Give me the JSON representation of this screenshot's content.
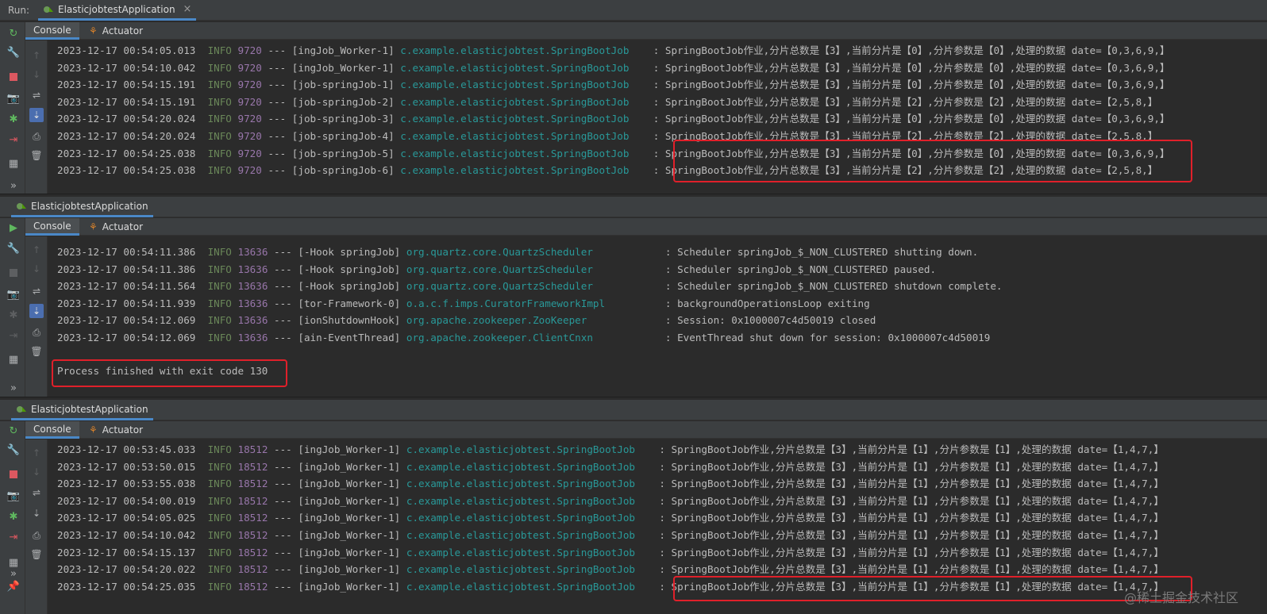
{
  "run_label": "Run:",
  "app_name": "ElasticjobtestApplication",
  "close_glyph": "×",
  "subtabs": {
    "console": "Console",
    "actuator": "Actuator"
  },
  "more_glyph": "»",
  "panel1": {
    "lines": [
      {
        "ts": "2023-12-17 00:54:05.013",
        "level": "INFO",
        "pid": "9720",
        "dash": "---",
        "thread": "[ingJob_Worker-1]",
        "logger": "c.example.elasticjobtest.SpringBootJob",
        "msg": ": SpringBootJob作业,分片总数是【3】,当前分片是【0】,分片参数是【0】,处理的数据 date=【0,3,6,9,】"
      },
      {
        "ts": "2023-12-17 00:54:10.042",
        "level": "INFO",
        "pid": "9720",
        "dash": "---",
        "thread": "[ingJob_Worker-1]",
        "logger": "c.example.elasticjobtest.SpringBootJob",
        "msg": ": SpringBootJob作业,分片总数是【3】,当前分片是【0】,分片参数是【0】,处理的数据 date=【0,3,6,9,】"
      },
      {
        "ts": "2023-12-17 00:54:15.191",
        "level": "INFO",
        "pid": "9720",
        "dash": "---",
        "thread": "[job-springJob-1]",
        "logger": "c.example.elasticjobtest.SpringBootJob",
        "msg": ": SpringBootJob作业,分片总数是【3】,当前分片是【0】,分片参数是【0】,处理的数据 date=【0,3,6,9,】"
      },
      {
        "ts": "2023-12-17 00:54:15.191",
        "level": "INFO",
        "pid": "9720",
        "dash": "---",
        "thread": "[job-springJob-2]",
        "logger": "c.example.elasticjobtest.SpringBootJob",
        "msg": ": SpringBootJob作业,分片总数是【3】,当前分片是【2】,分片参数是【2】,处理的数据 date=【2,5,8,】"
      },
      {
        "ts": "2023-12-17 00:54:20.024",
        "level": "INFO",
        "pid": "9720",
        "dash": "---",
        "thread": "[job-springJob-3]",
        "logger": "c.example.elasticjobtest.SpringBootJob",
        "msg": ": SpringBootJob作业,分片总数是【3】,当前分片是【0】,分片参数是【0】,处理的数据 date=【0,3,6,9,】"
      },
      {
        "ts": "2023-12-17 00:54:20.024",
        "level": "INFO",
        "pid": "9720",
        "dash": "---",
        "thread": "[job-springJob-4]",
        "logger": "c.example.elasticjobtest.SpringBootJob",
        "msg": ": SpringBootJob作业,分片总数是【3】,当前分片是【2】,分片参数是【2】,处理的数据 date=【2,5,8,】"
      },
      {
        "ts": "2023-12-17 00:54:25.038",
        "level": "INFO",
        "pid": "9720",
        "dash": "---",
        "thread": "[job-springJob-5]",
        "logger": "c.example.elasticjobtest.SpringBootJob",
        "msg": ": SpringBootJob作业,分片总数是【3】,当前分片是【0】,分片参数是【0】,处理的数据 date=【0,3,6,9,】"
      },
      {
        "ts": "2023-12-17 00:54:25.038",
        "level": "INFO",
        "pid": "9720",
        "dash": "---",
        "thread": "[job-springJob-6]",
        "logger": "c.example.elasticjobtest.SpringBootJob",
        "msg": ": SpringBootJob作业,分片总数是【3】,当前分片是【2】,分片参数是【2】,处理的数据 date=【2,5,8,】"
      }
    ]
  },
  "panel2": {
    "lines": [
      {
        "ts": "2023-12-17 00:54:11.386",
        "level": "INFO",
        "pid": "13636",
        "dash": "---",
        "thread": "[-Hook springJob]",
        "logger": "org.quartz.core.QuartzScheduler",
        "msg": ": Scheduler springJob_$_NON_CLUSTERED shutting down."
      },
      {
        "ts": "2023-12-17 00:54:11.386",
        "level": "INFO",
        "pid": "13636",
        "dash": "---",
        "thread": "[-Hook springJob]",
        "logger": "org.quartz.core.QuartzScheduler",
        "msg": ": Scheduler springJob_$_NON_CLUSTERED paused."
      },
      {
        "ts": "2023-12-17 00:54:11.564",
        "level": "INFO",
        "pid": "13636",
        "dash": "---",
        "thread": "[-Hook springJob]",
        "logger": "org.quartz.core.QuartzScheduler",
        "msg": ": Scheduler springJob_$_NON_CLUSTERED shutdown complete."
      },
      {
        "ts": "2023-12-17 00:54:11.939",
        "level": "INFO",
        "pid": "13636",
        "dash": "---",
        "thread": "[tor-Framework-0]",
        "logger": "o.a.c.f.imps.CuratorFrameworkImpl",
        "msg": ": backgroundOperationsLoop exiting"
      },
      {
        "ts": "2023-12-17 00:54:12.069",
        "level": "INFO",
        "pid": "13636",
        "dash": "---",
        "thread": "[ionShutdownHook]",
        "logger": "org.apache.zookeeper.ZooKeeper",
        "msg": ": Session: 0x1000007c4d50019 closed"
      },
      {
        "ts": "2023-12-17 00:54:12.069",
        "level": "INFO",
        "pid": "13636",
        "dash": "---",
        "thread": "[ain-EventThread]",
        "logger": "org.apache.zookeeper.ClientCnxn",
        "msg": ": EventThread shut down for session: 0x1000007c4d50019"
      }
    ],
    "process_finished": "Process finished with exit code 130"
  },
  "panel3": {
    "lines": [
      {
        "ts": "2023-12-17 00:53:45.033",
        "level": "INFO",
        "pid": "18512",
        "dash": "---",
        "thread": "[ingJob_Worker-1]",
        "logger": "c.example.elasticjobtest.SpringBootJob",
        "msg": ": SpringBootJob作业,分片总数是【3】,当前分片是【1】,分片参数是【1】,处理的数据 date=【1,4,7,】"
      },
      {
        "ts": "2023-12-17 00:53:50.015",
        "level": "INFO",
        "pid": "18512",
        "dash": "---",
        "thread": "[ingJob_Worker-1]",
        "logger": "c.example.elasticjobtest.SpringBootJob",
        "msg": ": SpringBootJob作业,分片总数是【3】,当前分片是【1】,分片参数是【1】,处理的数据 date=【1,4,7,】"
      },
      {
        "ts": "2023-12-17 00:53:55.038",
        "level": "INFO",
        "pid": "18512",
        "dash": "---",
        "thread": "[ingJob_Worker-1]",
        "logger": "c.example.elasticjobtest.SpringBootJob",
        "msg": ": SpringBootJob作业,分片总数是【3】,当前分片是【1】,分片参数是【1】,处理的数据 date=【1,4,7,】"
      },
      {
        "ts": "2023-12-17 00:54:00.019",
        "level": "INFO",
        "pid": "18512",
        "dash": "---",
        "thread": "[ingJob_Worker-1]",
        "logger": "c.example.elasticjobtest.SpringBootJob",
        "msg": ": SpringBootJob作业,分片总数是【3】,当前分片是【1】,分片参数是【1】,处理的数据 date=【1,4,7,】"
      },
      {
        "ts": "2023-12-17 00:54:05.025",
        "level": "INFO",
        "pid": "18512",
        "dash": "---",
        "thread": "[ingJob_Worker-1]",
        "logger": "c.example.elasticjobtest.SpringBootJob",
        "msg": ": SpringBootJob作业,分片总数是【3】,当前分片是【1】,分片参数是【1】,处理的数据 date=【1,4,7,】"
      },
      {
        "ts": "2023-12-17 00:54:10.042",
        "level": "INFO",
        "pid": "18512",
        "dash": "---",
        "thread": "[ingJob_Worker-1]",
        "logger": "c.example.elasticjobtest.SpringBootJob",
        "msg": ": SpringBootJob作业,分片总数是【3】,当前分片是【1】,分片参数是【1】,处理的数据 date=【1,4,7,】"
      },
      {
        "ts": "2023-12-17 00:54:15.137",
        "level": "INFO",
        "pid": "18512",
        "dash": "---",
        "thread": "[ingJob_Worker-1]",
        "logger": "c.example.elasticjobtest.SpringBootJob",
        "msg": ": SpringBootJob作业,分片总数是【3】,当前分片是【1】,分片参数是【1】,处理的数据 date=【1,4,7,】"
      },
      {
        "ts": "2023-12-17 00:54:20.022",
        "level": "INFO",
        "pid": "18512",
        "dash": "---",
        "thread": "[ingJob_Worker-1]",
        "logger": "c.example.elasticjobtest.SpringBootJob",
        "msg": ": SpringBootJob作业,分片总数是【3】,当前分片是【1】,分片参数是【1】,处理的数据 date=【1,4,7,】"
      },
      {
        "ts": "2023-12-17 00:54:25.035",
        "level": "INFO",
        "pid": "18512",
        "dash": "---",
        "thread": "[ingJob_Worker-1]",
        "logger": "c.example.elasticjobtest.SpringBootJob",
        "msg": ": SpringBootJob作业,分片总数是【3】,当前分片是【1】,分片参数是【1】,处理的数据 date=【1,4,7,】"
      }
    ]
  },
  "watermark": "@稀土掘金技术社区",
  "colors": {
    "info": "#6a8759",
    "pid": "#9876aa",
    "logger": "#299999",
    "highlight_box": "#e0202a",
    "tab_underline": "#4a88c7"
  },
  "icons": [
    "rerun-icon",
    "wrench-icon",
    "stop-icon",
    "camera-icon",
    "debug-icon",
    "exit-icon",
    "layout-icon",
    "more-icon",
    "pin-icon",
    "up-arrow-icon",
    "down-arrow-icon",
    "soft-wrap-icon",
    "scroll-to-end-icon",
    "print-icon",
    "trash-icon",
    "run-icon"
  ]
}
